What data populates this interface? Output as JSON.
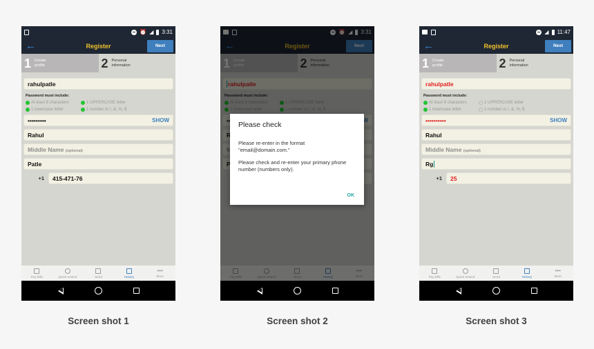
{
  "app": {
    "title": "Register",
    "back_icon": "arrow-left-icon",
    "next_label": "Next",
    "steps": [
      {
        "num": "1",
        "line1": "Create",
        "line2": "profile"
      },
      {
        "num": "2",
        "line1": "Personal",
        "line2": "information"
      }
    ],
    "password_rules_heading": "Password must include:",
    "password_rules": [
      "At least 8 characters",
      "1 UPPERCASE letter",
      "1 lowercase letter",
      "1 number or !, &, %, $"
    ],
    "show_label": "SHOW",
    "middle_name_placeholder": "Middle Name",
    "middle_name_optional": "(optional)",
    "country_code": "+1",
    "tabs": [
      {
        "label": "Pay bills",
        "icon": "pay-bills-icon"
      },
      {
        "label": "Quick resend",
        "icon": "quick-resend-icon"
      },
      {
        "label": "Send",
        "icon": "send-icon"
      },
      {
        "label": "History",
        "icon": "history-icon",
        "active": true
      },
      {
        "label": "More",
        "icon": "more-icon"
      }
    ],
    "colors": {
      "appbar": "#1e2733",
      "title": "#f2c12e",
      "accent": "#3f7fbd",
      "error": "#e01e1e",
      "rule_ok": "#22c431",
      "dialog_ok": "#1fa4a0"
    }
  },
  "screens": [
    {
      "caption": "Screen shot 1",
      "status_time": "3:31",
      "username": "rahulpatle",
      "password_mask": "•••••••••",
      "first_name": "Rahul",
      "last_name": "Patle",
      "phone": "415-471-76",
      "rules_met": [
        true,
        true,
        true,
        true
      ]
    },
    {
      "caption": "Screen shot 2",
      "status_time": "3:31",
      "username": "rahulpatle",
      "password_mask": "•••••••••",
      "first_name": "Rahul",
      "last_name": "Patle",
      "phone": "",
      "rules_met": [
        true,
        true,
        true,
        true
      ],
      "dialog": {
        "title": "Please check",
        "message1": "Please re-enter in the format \"email@domain.com.\"",
        "message2": "Please check and re-enter your primary phone number (numbers only).",
        "ok_label": "OK"
      }
    },
    {
      "caption": "Screen shot 3",
      "status_time": "11:47",
      "username": "rahulpatle",
      "password_mask": "••••••••••",
      "first_name": "Rahul",
      "last_name": "Rg",
      "phone": "25",
      "rules_met": [
        true,
        false,
        true,
        false
      ]
    }
  ]
}
